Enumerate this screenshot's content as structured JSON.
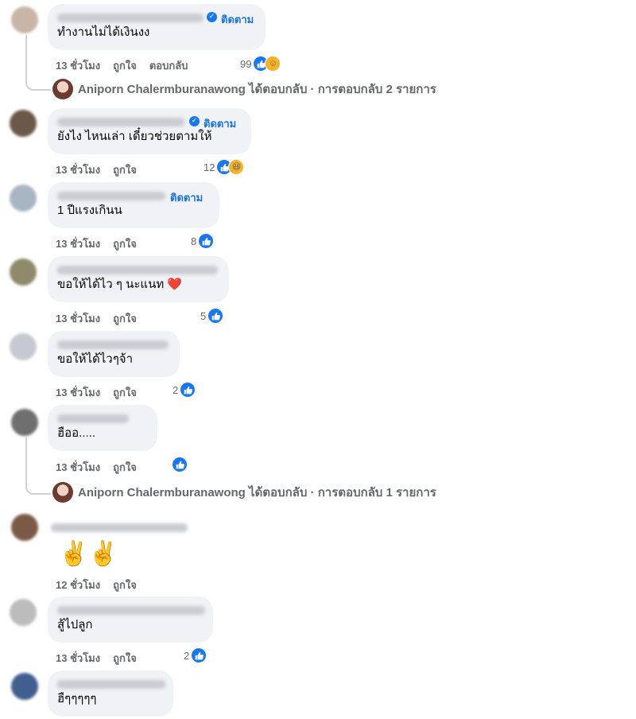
{
  "labels": {
    "like": "ถูกใจ",
    "reply": "ตอบกลับ",
    "follow": "ติดตาม"
  },
  "comments": [
    {
      "text": "ทำงานไม่ได้เงินงง",
      "time": "13 ชั่วโมง",
      "reaction_count": "99",
      "reaction_extra": "hug-face",
      "avatar_color": "#c8b5a6"
    },
    {
      "text": "ยังไง ไหนเล่า เดี๋ยวช่วยตามให้",
      "time": "13 ชั่วโมง",
      "reaction_count": "12",
      "reaction_extra": "haha-face",
      "avatar_color": "#6b5848"
    },
    {
      "text": "1 ปีแรงเกินน",
      "time": "13 ชั่วโมง",
      "reaction_count": "8",
      "avatar_color": "#a8b6c4"
    },
    {
      "text": "ขอให้ได้ไว ๆ นะแนท ❤️",
      "time": "13 ชั่วโมง",
      "reaction_count": "5",
      "avatar_color": "#8f8a6c"
    },
    {
      "text": "ขอให้ได้ไวๆจ้า",
      "time": "13 ชั่วโมง",
      "reaction_count": "2",
      "avatar_color": "#c6c9d1"
    },
    {
      "text": "ฮืออ.....",
      "time": "13 ชั่วโมง",
      "reaction_count": "",
      "avatar_color": "#6f6f70"
    },
    {
      "text": "✌️✌️",
      "time": "12 ชั่วโมง",
      "reaction_count": "",
      "avatar_color": "#7b5a45"
    },
    {
      "text": "สู้ไปลูก",
      "time": "13 ชั่วโมง",
      "reaction_count": "2",
      "avatar_color": "#bcbcbc"
    },
    {
      "text": "ฮืๆๆๆๆๆ",
      "time": "",
      "reaction_count": "",
      "avatar_color": "#3f5f8f"
    }
  ],
  "replies": [
    {
      "name": "Aniporn Chalermburanawong",
      "text": "ได้ตอบกลับ · การตอบกลับ 2 รายการ"
    },
    {
      "name": "Aniporn Chalermburanawong",
      "text": "ได้ตอบกลับ · การตอบกลับ 1 รายการ"
    }
  ],
  "colors": {
    "link": "#1b74e4",
    "meta": "#65676b",
    "bubble": "#f0f2f5",
    "like": "#1877f2"
  }
}
